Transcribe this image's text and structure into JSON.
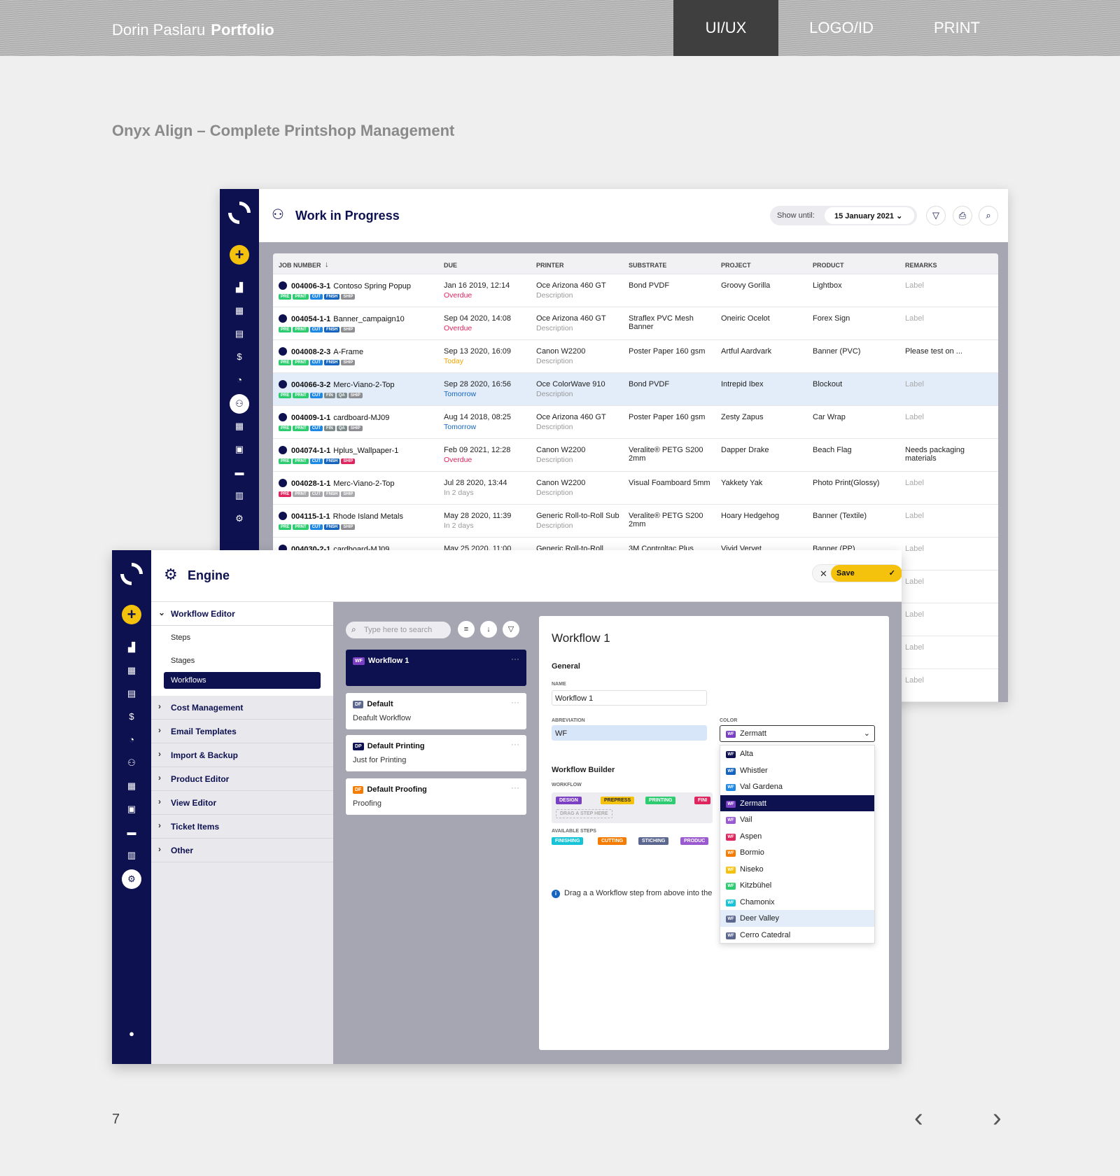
{
  "header": {
    "author": "Dorin Paslaru",
    "portfolio": "Portfolio",
    "tabs": [
      {
        "label": "UI/UX",
        "active": true
      },
      {
        "label": "LOGO/ID"
      },
      {
        "label": "PRINT"
      }
    ]
  },
  "page_title": "Onyx Align – Complete Printshop Management",
  "wip": {
    "title": "Work in Progress",
    "show_until_label": "Show until:",
    "show_until_value": "15 January 2021",
    "columns": [
      "JOB NUMBER",
      "DUE",
      "PRINTER",
      "SUBSTRATE",
      "PROJECT",
      "PRODUCT",
      "REMARKS"
    ],
    "rows": [
      {
        "job": "004006-3-1",
        "name": "Contoso Spring Popup",
        "tags": [
          "PRE",
          "PRNT",
          "CUT",
          "FNSH",
          "SHIP"
        ],
        "due": "Jan 16 2019, 12:14",
        "status": "Overdue",
        "printer": "Oce Arizona 460 GT",
        "printer_desc": "Description",
        "substrate": "Bond PVDF",
        "project": "Groovy Gorilla",
        "product": "Lightbox",
        "remarks": "Label"
      },
      {
        "job": "004054-1-1",
        "name": "Banner_campaign10",
        "tags": [
          "PRE",
          "PRNT",
          "CUT",
          "FNSH",
          "SHIP"
        ],
        "due": "Sep 04 2020, 14:08",
        "status": "Overdue",
        "printer": "Oce Arizona 460 GT",
        "printer_desc": "Description",
        "substrate": "Straflex PVC Mesh Banner",
        "project": "Oneiric Ocelot",
        "product": "Forex Sign",
        "remarks": "Label"
      },
      {
        "job": "004008-2-3",
        "name": "A-Frame",
        "tags": [
          "PRE",
          "PRNT",
          "CUT",
          "FNSH",
          "SHIP"
        ],
        "due": "Sep 13 2020, 16:09",
        "status": "Today",
        "printer": "Canon W2200",
        "printer_desc": "Description",
        "substrate": "Poster Paper 160 gsm",
        "project": "Artful Aardvark",
        "product": "Banner (PVC)",
        "remarks": "Please test on ..."
      },
      {
        "job": "004066-3-2",
        "name": "Merc-Viano-2-Top",
        "tags": [
          "PRE",
          "PRNT",
          "CUT",
          "FIN",
          "QA",
          "SHIP"
        ],
        "due": "Sep 28 2020, 16:56",
        "status": "Tomorrow",
        "printer": "Oce ColorWave 910",
        "printer_desc": "Description",
        "substrate": "Bond PVDF",
        "project": "Intrepid Ibex",
        "product": "Blockout",
        "remarks": "Label"
      },
      {
        "job": "004009-1-1",
        "name": "cardboard-MJ09",
        "tags": [
          "PRE",
          "PRNT",
          "CUT",
          "FIN",
          "QA",
          "SHIP"
        ],
        "due": "Aug 14 2018, 08:25",
        "status": "Tomorrow",
        "printer": "Oce Arizona 460 GT",
        "printer_desc": "Description",
        "substrate": "Poster Paper 160 gsm",
        "project": "Zesty Zapus",
        "product": "Car Wrap",
        "remarks": "Label"
      },
      {
        "job": "004074-1-1",
        "name": "Hplus_Wallpaper-1",
        "tags": [
          "PRE",
          "PRNT",
          "CUT",
          "FNSH",
          "SHIP"
        ],
        "due": "Feb 09 2021, 12:28",
        "status": "Overdue",
        "printer": "Canon W2200",
        "printer_desc": "Description",
        "substrate": "Veralite® PETG S200 2mm",
        "project": "Dapper Drake",
        "product": "Beach Flag",
        "remarks": "Needs packaging materials"
      },
      {
        "job": "004028-1-1",
        "name": "Merc-Viano-2-Top",
        "tags": [
          "PRE",
          "PRNT",
          "CUT",
          "FNSH",
          "SHIP"
        ],
        "due": "Jul 28 2020, 13:44",
        "status": "In 2 days",
        "printer": "Canon W2200",
        "printer_desc": "Description",
        "substrate": "Visual Foamboard 5mm",
        "project": "Yakkety Yak",
        "product": "Photo Print(Glossy)",
        "remarks": "Label"
      },
      {
        "job": "004115-1-1",
        "name": "Rhode Island Metals",
        "tags": [
          "PRE",
          "PRNT",
          "CUT",
          "FNSH",
          "SHIP"
        ],
        "due": "May 28 2020, 11:39",
        "status": "In 2 days",
        "printer": "Generic Roll-to-Roll Sub",
        "printer_desc": "Description",
        "substrate": "Veralite® PETG S200 2mm",
        "project": "Hoary Hedgehog",
        "product": "Banner (Textile)",
        "remarks": "Label"
      },
      {
        "job": "004030-2-1",
        "name": "cardboard-MJ09",
        "tags": [],
        "due": "May 25 2020, 11:00",
        "status": "",
        "printer": "Generic Roll-to-Roll",
        "printer_desc": "",
        "substrate": "3M Controltac Plus",
        "project": "Vivid Vervet",
        "product": "Banner (PP)",
        "remarks": "Label"
      }
    ],
    "extra_remarks": [
      "Label",
      "Label",
      "Label",
      "Label",
      "Label"
    ]
  },
  "engine": {
    "title": "Engine",
    "save_label": "Save",
    "menu": {
      "open": "Workflow Editor",
      "sub": [
        "Steps",
        "Stages",
        "Workflows"
      ],
      "items": [
        "Cost Management",
        "Email Templates",
        "Import & Backup",
        "Product Editor",
        "View Editor",
        "Ticket Items",
        "Other"
      ]
    },
    "search_placeholder": "Type here to search",
    "workflows": [
      {
        "abbr": "WF",
        "name": "Workflow 1",
        "desc": ""
      },
      {
        "abbr": "DF",
        "name": "Default",
        "desc": "Deafult Workflow"
      },
      {
        "abbr": "DP",
        "name": "Default Printing",
        "desc": "Just for Printing"
      },
      {
        "abbr": "DF",
        "name": "Default Proofing",
        "desc": "Proofing"
      }
    ],
    "detail": {
      "title": "Workflow 1",
      "general": "General",
      "name_label": "NAME",
      "name_value": "Workflow 1",
      "abbr_label": "ABREVIATION",
      "abbr_value": "WF",
      "color_label": "COLOR",
      "color_value": "Zermatt",
      "builder": "Workflow Builder",
      "workflow_label": "WORKFLOW",
      "workflow_chips": [
        "DESIGN",
        "PREPRESS",
        "PRINTING",
        "FINI"
      ],
      "drag_here": "DRAG A STEP HERE",
      "available_label": "AVAILABLE STEPS",
      "available_chips": [
        "FINISHING",
        "CUTTING",
        "STICHING",
        "PRODUC"
      ],
      "info": "Drag a a Workflow step from above into the",
      "colors": [
        "Alta",
        "Whistler",
        "Val Gardena",
        "Zermatt",
        "Vail",
        "Aspen",
        "Bormio",
        "Niseko",
        "Kitzbühel",
        "Chamonix",
        "Deer Valley",
        "Cerro Catedral"
      ]
    }
  },
  "page_number": "7",
  "palette": {
    "navy": "#0e1150",
    "yellow": "#f4c20d",
    "pre": "#2ecc71",
    "cut": "#1565c0",
    "fnsh": "#0d47a1",
    "ship": "#9e9e9e",
    "overdue": "#e0245e",
    "today": "#f0a500"
  }
}
